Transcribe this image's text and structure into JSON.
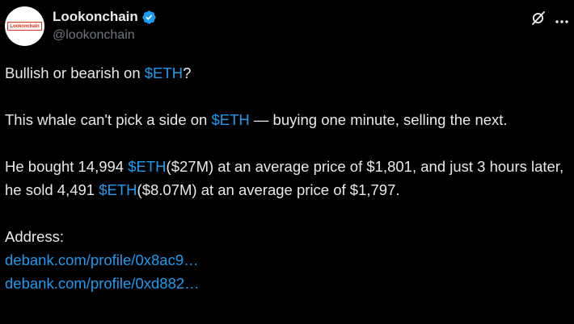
{
  "author": {
    "display_name": "Lookonchain",
    "handle": "@lookonchain",
    "avatar_text": "Lookonchain",
    "verified": true
  },
  "header_icons": {
    "grok": "grok-icon",
    "more": "more-icon"
  },
  "tweet": {
    "line1": {
      "before": "Bullish or bearish on ",
      "tag": "$ETH",
      "after": "?"
    },
    "line2": {
      "before": "This whale can't pick a side on ",
      "tag": "$ETH",
      "after": " — buying one minute, selling the next."
    },
    "line3": {
      "part1": "He bought 14,994 ",
      "tag1": "$ETH",
      "part2": "($27M) at an average price of $1,801, and just 3 hours later, he sold 4,491 ",
      "tag2": "$ETH",
      "part3": "($8.07M) at an average price of $1,797."
    },
    "address_label": "Address:",
    "links": [
      "debank.com/profile/0x8ac9…",
      "debank.com/profile/0xd882…"
    ]
  },
  "colors": {
    "background": "#000000",
    "text": "#e7e9ea",
    "muted": "#71767b",
    "accent": "#1d9bf0",
    "logo_red": "#e0301e"
  }
}
